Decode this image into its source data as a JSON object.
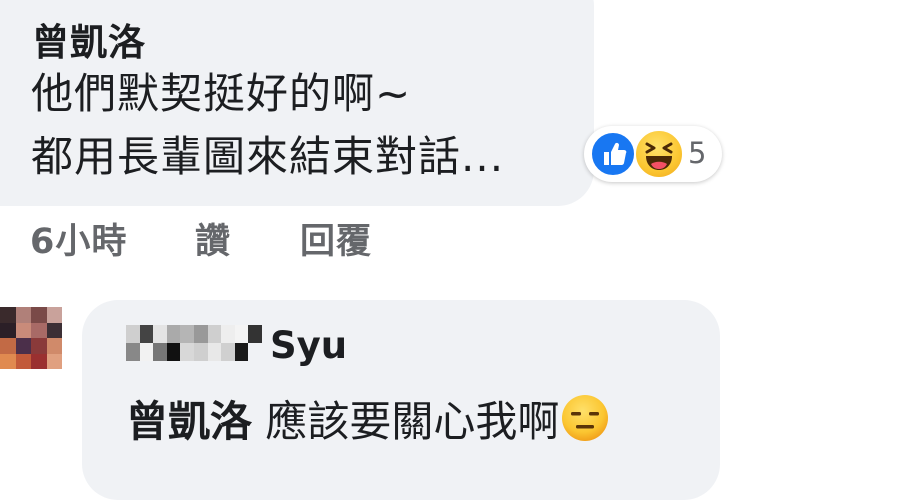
{
  "comment": {
    "author": "曾凱洛",
    "text_line1": "他們默契挺好的啊~",
    "text_line2": "都用長輩圖來結束對話...",
    "reactions": {
      "icons": [
        "like-icon",
        "haha-icon"
      ],
      "count": "5"
    },
    "actions": {
      "time": "6小時",
      "like": "讚",
      "reply": "回覆"
    }
  },
  "reply": {
    "author_visible_suffix": "Syu",
    "mention": "曾凱洛",
    "text": "應該要關心我啊",
    "emoji": "expressionless-face-icon"
  },
  "colors": {
    "bubble": "#f0f2f5",
    "text": "#1c1e21",
    "secondary": "#65676b",
    "like_blue": "#1877f2",
    "emoji_yellow": "#fbc631"
  }
}
